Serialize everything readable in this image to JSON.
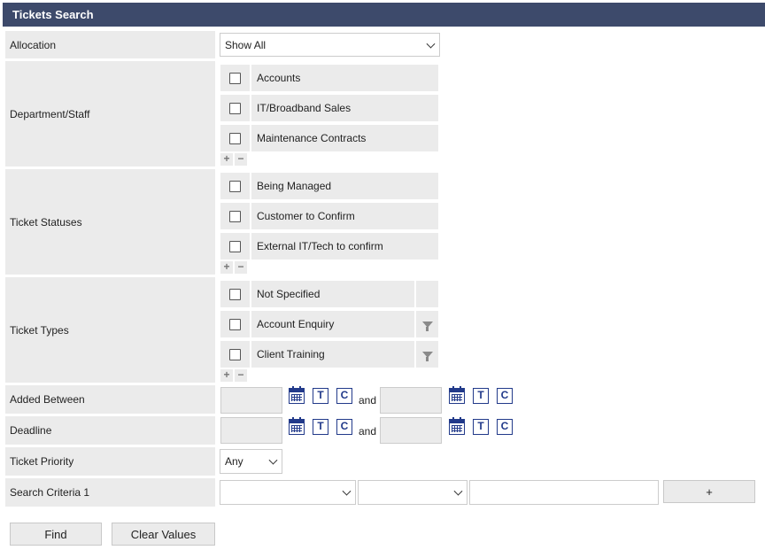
{
  "header": {
    "title": "Tickets Search"
  },
  "allocation": {
    "label": "Allocation",
    "value": "Show All"
  },
  "department": {
    "label": "Department/Staff",
    "items": [
      "Accounts",
      "IT/Broadband Sales",
      "Maintenance Contracts"
    ]
  },
  "statuses": {
    "label": "Ticket Statuses",
    "items": [
      "Being Managed",
      "Customer to Confirm",
      "External IT/Tech to confirm"
    ]
  },
  "types": {
    "label": "Ticket Types",
    "items": [
      "Not Specified",
      "Account Enquiry",
      "Client Training"
    ]
  },
  "plus_minus": {
    "plus": "+",
    "minus": "−"
  },
  "added_between": {
    "label": "Added Between",
    "and": "and"
  },
  "deadline": {
    "label": "Deadline",
    "and": "and"
  },
  "date_buttons": {
    "today": "T",
    "clear": "C"
  },
  "priority": {
    "label": "Ticket Priority",
    "value": "Any"
  },
  "criteria": {
    "label": "Search Criteria 1",
    "add": "+"
  },
  "buttons": {
    "find": "Find",
    "clear_values": "Clear Values"
  },
  "colors": {
    "header_bg": "#3d4a6b",
    "label_bg": "#ebebeb",
    "icon_blue": "#223a8a"
  },
  "icons": [
    "chevron-down-icon",
    "calendar-icon",
    "filter-icon",
    "plus-icon",
    "minus-icon"
  ]
}
